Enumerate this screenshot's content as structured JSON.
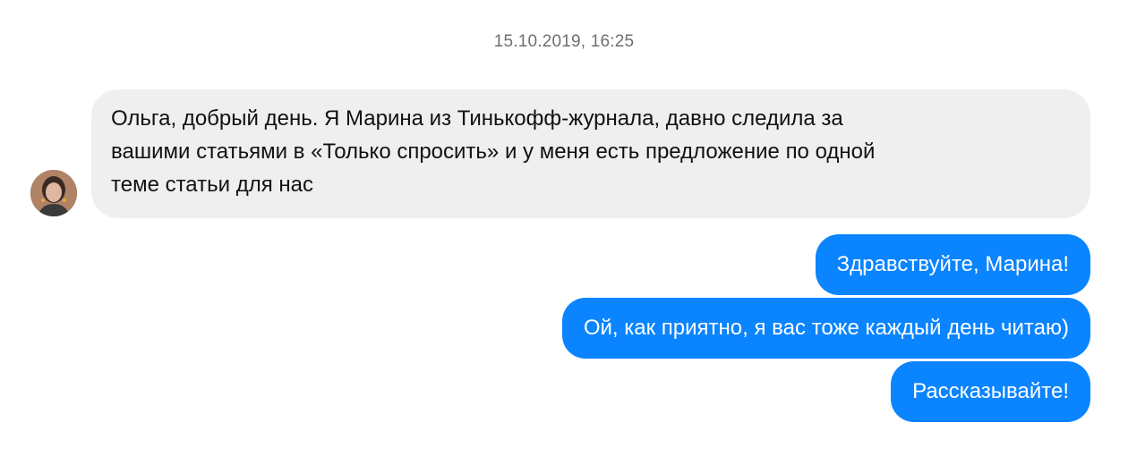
{
  "chat": {
    "timestamp": "15.10.2019, 16:25",
    "incoming": {
      "sender_avatar": "avatar-photo",
      "text": "Ольга, добрый день. Я Марина из Тинькофф-журнала, давно следила за\nвашими статьями в «Только спросить» и у меня есть предложение по одной\nтеме статьи для нас"
    },
    "outgoing": [
      {
        "text": "Здравствуйте, Марина!"
      },
      {
        "text": "Ой, как приятно, я вас тоже каждый день читаю)"
      },
      {
        "text": "Рассказывайте!"
      }
    ]
  },
  "colors": {
    "incoming_bubble": "#efefef",
    "outgoing_bubble": "#0a84ff",
    "timestamp": "#6f6f6f"
  }
}
